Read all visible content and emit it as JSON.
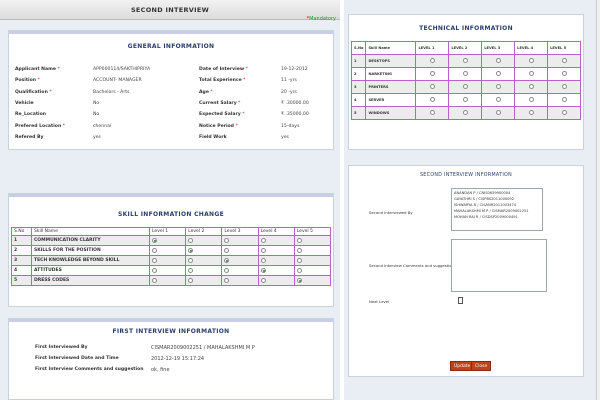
{
  "left": {
    "header": "SECOND INTERVIEW",
    "mandatory": "Mandatory",
    "general": {
      "title": "GENERAL INFORMATION",
      "rows": [
        {
          "l1": "Applicant Name",
          "r1": true,
          "v1": "APP000114/SAKTHIPRIYA",
          "l2": "Date of Interview",
          "r2": true,
          "v2": "19-12-2012"
        },
        {
          "l1": "Position",
          "r1": true,
          "v1": "ACCOUNT- MANAGER",
          "l2": "Total Experience",
          "r2": true,
          "v2": "11 -yrs"
        },
        {
          "l1": "Qualification",
          "r1": true,
          "v1": "Bachelors - Arts",
          "l2": "Age",
          "r2": true,
          "v2": "20 -yrs"
        },
        {
          "l1": "Vehicle",
          "r1": false,
          "v1": "No",
          "l2": "Current Salary",
          "r2": true,
          "v2": "₹ .30000.00"
        },
        {
          "l1": "Re_Location",
          "r1": false,
          "v1": "No",
          "l2": "Expected Salary",
          "r2": true,
          "v2": "₹ .35000.00"
        },
        {
          "l1": "Prefered Location",
          "r1": true,
          "v1": "chennai",
          "l2": "Notice Period",
          "r2": true,
          "v2": "15-days"
        },
        {
          "l1": "Refered By",
          "r1": false,
          "v1": "yes",
          "l2": "Field Work",
          "r2": false,
          "v2": "yes"
        }
      ]
    },
    "skill": {
      "title": "SKILL INFORMATION CHANGE",
      "headers": [
        "S.No",
        "Skill Name",
        "Level 1",
        "Level 2",
        "Level 3",
        "Level 4",
        "Level 5"
      ],
      "rows": [
        {
          "no": "1",
          "name": "COMMUNICATION CLARITY",
          "level": 1
        },
        {
          "no": "2",
          "name": "SKILLS FOR THE POSITION",
          "level": 2
        },
        {
          "no": "3",
          "name": "TECH KNOWLEDGE BEYOND SKILL",
          "level": 3
        },
        {
          "no": "4",
          "name": "ATTITUDES",
          "level": 4
        },
        {
          "no": "5",
          "name": "DRESS CODES",
          "level": 5
        }
      ]
    },
    "first": {
      "title": "FIRST INTERVIEW INFORMATION",
      "rows": [
        {
          "label": "First Interviewed By",
          "value": "CISMAR2009002251 / MAHALAKSHMI M P"
        },
        {
          "label": "First Interviewed Date and Time",
          "value": "2012-12-19 15:17:24"
        },
        {
          "label": "First Interview Comments and suggestion",
          "value": "ok, fine"
        }
      ]
    }
  },
  "right": {
    "technical": {
      "title": "TECHNICAL INFORMATION",
      "headers": [
        "S.No",
        "Skill Name",
        "LEVEL 1",
        "LEVEL 2",
        "LEVEL 3",
        "LEVEL 4",
        "LEVEL 5"
      ],
      "rows": [
        {
          "no": "1",
          "name": "DESKTOPS"
        },
        {
          "no": "2",
          "name": "NARKETING"
        },
        {
          "no": "3",
          "name": "PRINTERS"
        },
        {
          "no": "4",
          "name": "SERVER"
        },
        {
          "no": "5",
          "name": "WINDOWS"
        }
      ]
    },
    "second": {
      "title": "SECOND INTERVIEW INFORMATION",
      "interviewed_by_label": "Second Interviewed By",
      "interviewers": [
        "ANANDAN P / CNIS0639900004",
        "GAYATHRI S / CISPBS2011000092",
        "ISHWARYA R / CISANR2011003474",
        "MAHALAKSHMI M P / CISMAR2009002251",
        "MOHAN RAJ R / CISDSP2009000491"
      ],
      "comments_label": "Second Interview Comments and suggestion",
      "next_level_label": "Next Level"
    },
    "buttons": {
      "update": "Update",
      "close": "Close"
    }
  }
}
